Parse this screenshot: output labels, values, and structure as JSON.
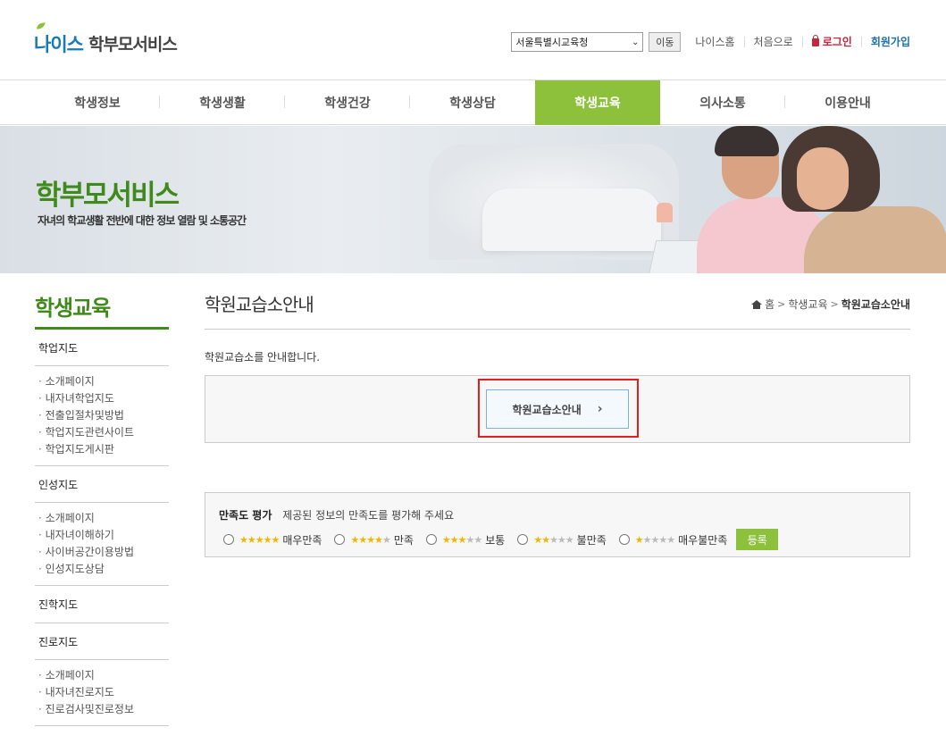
{
  "header": {
    "logo_neis": "나이스",
    "logo_service": "학부모서비스",
    "office_select_value": "서울특별시교육청",
    "go_label": "이동",
    "links": {
      "neis_home": "나이스홈",
      "first": "처음으로",
      "login": "로그인",
      "join": "회원가입"
    }
  },
  "gnb": {
    "items": [
      "학생정보",
      "학생생활",
      "학생건강",
      "학생상담",
      "학생교육",
      "의사소통",
      "이용안내"
    ],
    "active": "학생교육"
  },
  "banner": {
    "title": "학부모서비스",
    "subtitle": "자녀의 학교생활 전반에 대한 정보 열람 및 소통공간"
  },
  "lnb": {
    "title": "학생교육",
    "groups": [
      {
        "label": "학업지도",
        "items": [
          "소개페이지",
          "내자녀학업지도",
          "전출입절차및방법",
          "학업지도관련사이트",
          "학업지도게시판"
        ]
      },
      {
        "label": "인성지도",
        "items": [
          "소개페이지",
          "내자녀이해하기",
          "사이버공간이용방법",
          "인성지도상담"
        ]
      },
      {
        "label": "진학지도",
        "items": []
      },
      {
        "label": "진로지도",
        "items": [
          "소개페이지",
          "내자녀진로지도",
          "진로검사및진로정보"
        ]
      }
    ]
  },
  "content": {
    "page_title": "학원교습소안내",
    "breadcrumb": [
      "홈",
      "학생교육",
      "학원교습소안내"
    ],
    "intro": "학원교습소를 안내합니다.",
    "go_button": "학원교습소안내"
  },
  "survey": {
    "title": "만족도 평가",
    "description": "제공된 정보의 만족도를 평가해 주세요",
    "options": [
      {
        "label": "매우만족",
        "stars": 5
      },
      {
        "label": "만족",
        "stars": 4
      },
      {
        "label": "보통",
        "stars": 3
      },
      {
        "label": "불만족",
        "stars": 2
      },
      {
        "label": "매우불만족",
        "stars": 1
      }
    ],
    "submit": "등록"
  },
  "colors": {
    "accent_green": "#8dc13c",
    "title_green": "#3f8a1a",
    "login_red": "#c8253a",
    "join_blue": "#1e6fa8"
  }
}
